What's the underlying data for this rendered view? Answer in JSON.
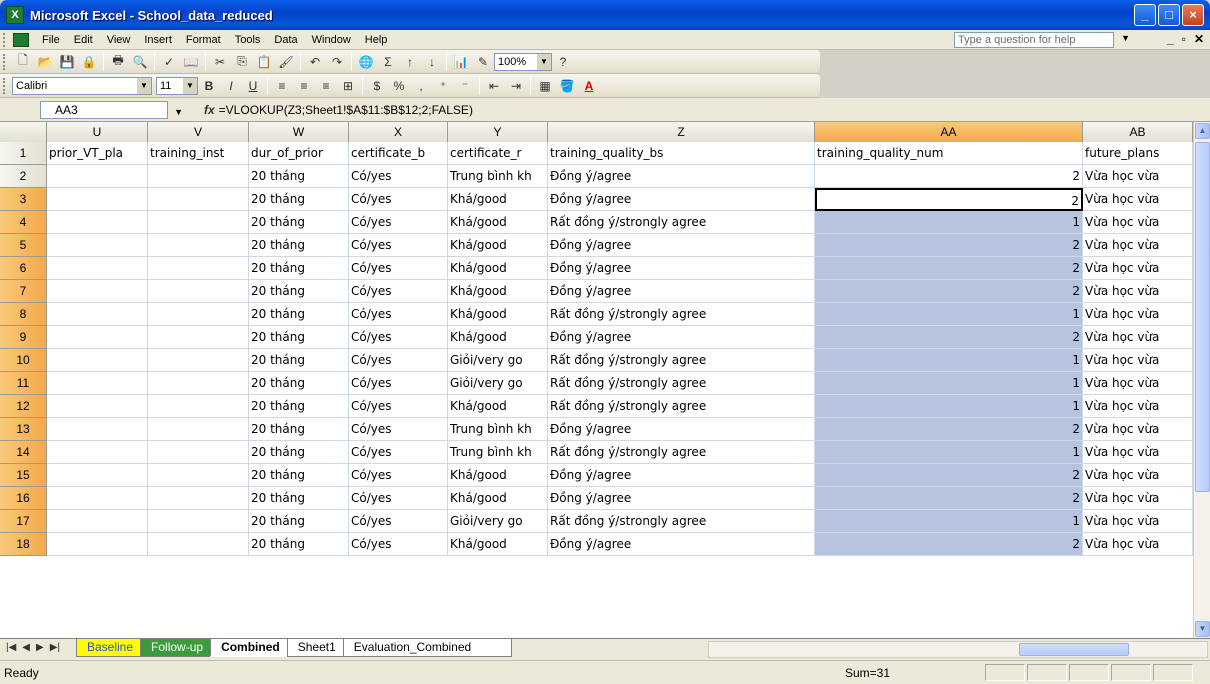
{
  "window": {
    "title": "Microsoft Excel - School_data_reduced",
    "app_icon": "X"
  },
  "menu": [
    "File",
    "Edit",
    "View",
    "Insert",
    "Format",
    "Tools",
    "Data",
    "Window",
    "Help"
  ],
  "help_box": {
    "placeholder": "Type a question for help"
  },
  "toolbar": {
    "zoom": "100%",
    "font_name": "Calibri",
    "font_size": "11"
  },
  "formula_bar": {
    "name_box": "AA3",
    "fx": "fx",
    "formula": "=VLOOKUP(Z3;Sheet1!$A$11:$B$12;2;FALSE)"
  },
  "columns": [
    "U",
    "V",
    "W",
    "X",
    "Y",
    "Z",
    "AA",
    "AB"
  ],
  "rows": [
    {
      "n": "1",
      "U": "prior_VT_pla",
      "V": "training_inst",
      "W": "dur_of_prior",
      "X": "certificate_b",
      "Y": "certificate_r",
      "Z": "training_quality_bs",
      "AA": "training_quality_num",
      "AB": "future_plans"
    },
    {
      "n": "2",
      "W": "20 tháng",
      "X": "Có/yes",
      "Y": "Trung bình kh",
      "Z": "Đồng ý/agree",
      "AA": "2",
      "AB": "Vừa học vừa"
    },
    {
      "n": "3",
      "W": "20 tháng",
      "X": "Có/yes",
      "Y": "Khá/good",
      "Z": "Đồng ý/agree",
      "AA": "2",
      "AB": "Vừa học vừa"
    },
    {
      "n": "4",
      "W": "20 tháng",
      "X": "Có/yes",
      "Y": "Khá/good",
      "Z": "Rất đồng ý/strongly agree",
      "AA": "1",
      "AB": "Vừa học vừa"
    },
    {
      "n": "5",
      "W": "20 tháng",
      "X": "Có/yes",
      "Y": "Khá/good",
      "Z": "Đồng ý/agree",
      "AA": "2",
      "AB": "Vừa học vừa"
    },
    {
      "n": "6",
      "W": "20 tháng",
      "X": "Có/yes",
      "Y": "Khá/good",
      "Z": "Đồng ý/agree",
      "AA": "2",
      "AB": "Vừa học vừa"
    },
    {
      "n": "7",
      "W": "20 tháng",
      "X": "Có/yes",
      "Y": "Khá/good",
      "Z": "Đồng ý/agree",
      "AA": "2",
      "AB": "Vừa học vừa"
    },
    {
      "n": "8",
      "W": "20 tháng",
      "X": "Có/yes",
      "Y": "Khá/good",
      "Z": "Rất đồng ý/strongly agree",
      "AA": "1",
      "AB": "Vừa học vừa"
    },
    {
      "n": "9",
      "W": "20 tháng",
      "X": "Có/yes",
      "Y": "Khá/good",
      "Z": "Đồng ý/agree",
      "AA": "2",
      "AB": "Vừa học vừa"
    },
    {
      "n": "10",
      "W": "20 tháng",
      "X": "Có/yes",
      "Y": "Giỏi/very go",
      "Z": "Rất đồng ý/strongly agree",
      "AA": "1",
      "AB": "Vừa học vừa"
    },
    {
      "n": "11",
      "W": "20 tháng",
      "X": "Có/yes",
      "Y": "Giỏi/very go",
      "Z": "Rất đồng ý/strongly agree",
      "AA": "1",
      "AB": "Vừa học vừa"
    },
    {
      "n": "12",
      "W": "20 tháng",
      "X": "Có/yes",
      "Y": "Khá/good",
      "Z": "Rất đồng ý/strongly agree",
      "AA": "1",
      "AB": "Vừa học vừa"
    },
    {
      "n": "13",
      "W": "20 tháng",
      "X": "Có/yes",
      "Y": "Trung bình kh",
      "Z": "Đồng ý/agree",
      "AA": "2",
      "AB": "Vừa học vừa"
    },
    {
      "n": "14",
      "W": "20 tháng",
      "X": "Có/yes",
      "Y": "Trung bình kh",
      "Z": "Rất đồng ý/strongly agree",
      "AA": "1",
      "AB": "Vừa học vừa"
    },
    {
      "n": "15",
      "W": "20 tháng",
      "X": "Có/yes",
      "Y": "Khá/good",
      "Z": "Đồng ý/agree",
      "AA": "2",
      "AB": "Vừa học vừa"
    },
    {
      "n": "16",
      "W": "20 tháng",
      "X": "Có/yes",
      "Y": "Khá/good",
      "Z": "Đồng ý/agree",
      "AA": "2",
      "AB": "Vừa học vừa"
    },
    {
      "n": "17",
      "W": "20 tháng",
      "X": "Có/yes",
      "Y": "Giỏi/very go",
      "Z": "Rất đồng ý/strongly agree",
      "AA": "1",
      "AB": "Vừa học vừa"
    },
    {
      "n": "18",
      "W": "20 tháng",
      "X": "Có/yes",
      "Y": "Khá/good",
      "Z": "Đồng ý/agree",
      "AA": "2",
      "AB": "Vừa học vừa"
    }
  ],
  "sheet_tabs": [
    "Baseline",
    "Follow-up",
    "Combined",
    "Sheet1",
    "Evaluation_Combined"
  ],
  "active_sheet": "Combined",
  "status": {
    "left": "Ready",
    "sum": "Sum=31"
  },
  "colors": {
    "selection": "#b6c4e0",
    "header_selected": "#f3a94b",
    "title_bar": "#0443c8"
  }
}
